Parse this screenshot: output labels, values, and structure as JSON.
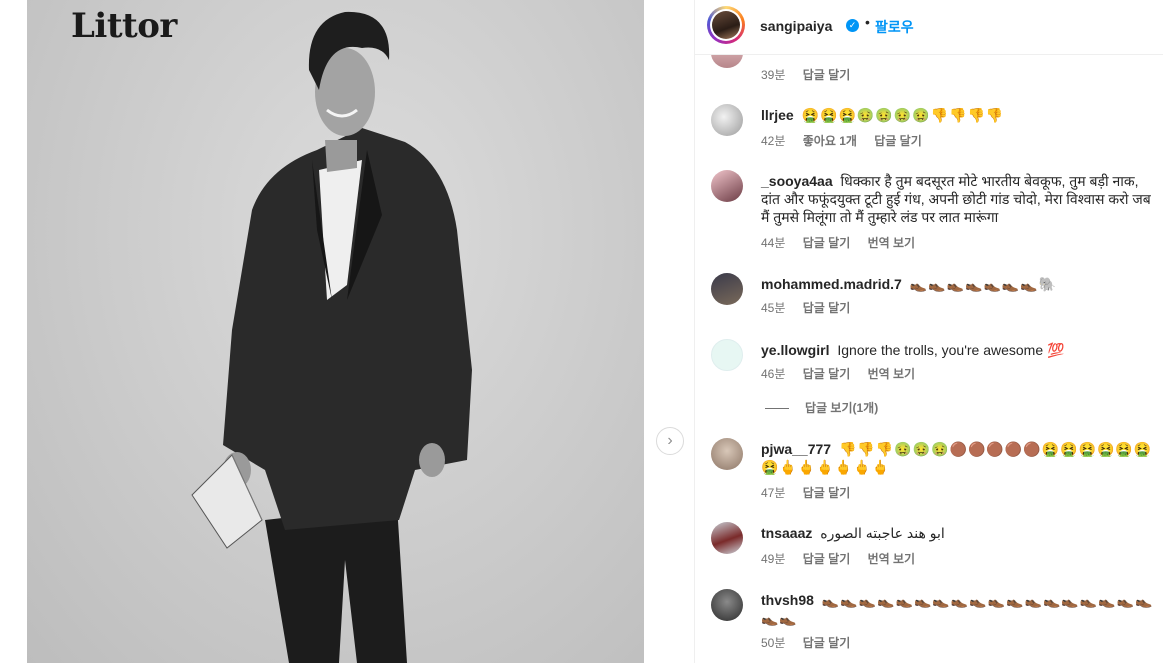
{
  "post": {
    "logo": "Littor"
  },
  "header": {
    "username": "sangipaiya",
    "dot": "•",
    "follow_label": "팔로우"
  },
  "comments": [
    {
      "username": "",
      "text": "",
      "time": "39분",
      "likes": "",
      "reply": "답글 달기",
      "translate": ""
    },
    {
      "username": "llrjee",
      "text": "🤮🤮🤮🤢🤢🤢🤢👎👎👎👎",
      "time": "42분",
      "likes": "좋아요 1개",
      "reply": "답글 달기",
      "translate": ""
    },
    {
      "username": "_sooya4aa",
      "text": "धिक्कार है तुम बदसूरत मोटे भारतीय बेवकूफ, तुम बड़ी नाक, दांत और फफूंदयुक्त टूटी हुई गंध, अपनी छोटी गांड चोदो, मेरा विश्वास करो जब मैं तुमसे मिलूंगा तो मैं तुम्हारे लंड पर लात मारूंगा",
      "time": "44분",
      "likes": "",
      "reply": "답글 달기",
      "translate": "번역 보기"
    },
    {
      "username": "mohammed.madrid.7",
      "text": "👞👞👞👞👞👞👞🐘",
      "time": "45분",
      "likes": "",
      "reply": "답글 달기",
      "translate": ""
    },
    {
      "username": "ye.llowgirl",
      "text": "Ignore the trolls, you're awesome 💯",
      "time": "46분",
      "likes": "",
      "reply": "답글 달기",
      "translate": "번역 보기"
    },
    {
      "username": "pjwa__777",
      "text": "👎👎👎🤢🤢🤢🟤🟤🟤🟤🟤🤮🤮🤮🤮🤮🤮🤮🖕🖕🖕🖕🖕🖕",
      "time": "47분",
      "likes": "",
      "reply": "답글 달기",
      "translate": ""
    },
    {
      "username": "tnsaaaz",
      "text": "ابو هند عاجبته الصوره",
      "time": "49분",
      "likes": "",
      "reply": "답글 달기",
      "translate": "번역 보기"
    },
    {
      "username": "thvsh98",
      "text": "👞👞👞👞👞👞👞👞👞👞👞👞👞👞👞👞👞👞👞👞",
      "time": "50분",
      "likes": "",
      "reply": "답글 달기",
      "translate": ""
    }
  ],
  "view_replies": "답글 보기(1개)",
  "colors": {
    "accent": "#0095f6",
    "meta": "#737373",
    "text": "#262626"
  }
}
